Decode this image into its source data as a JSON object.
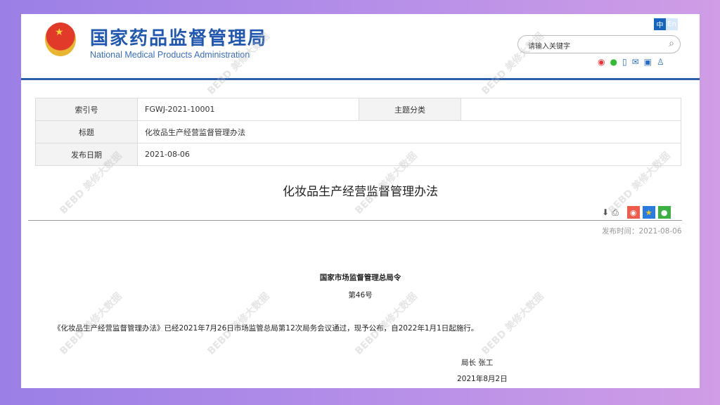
{
  "header": {
    "logo_cn": "国家药品监督管理局",
    "logo_en": "National Medical Products Administration",
    "lang_zh": "中",
    "lang_en": "En",
    "search_placeholder": "请输入关键字"
  },
  "info_table": [
    {
      "label": "索引号",
      "value": "FGWJ-2021-10001",
      "label2": "主题分类",
      "value2": ""
    },
    {
      "label": "标题",
      "value": "化妆品生产经营监督管理办法"
    },
    {
      "label": "发布日期",
      "value": "2021-08-06"
    }
  ],
  "article": {
    "title": "化妆品生产经营监督管理办法",
    "publish_time": "发布时间：2021-08-06",
    "issuer": "国家市场监督管理总局令",
    "number": "第46号",
    "paragraph": "《化妆品生产经营监督管理办法》已经2021年7月26日市场监管总局第12次局务会议通过，现予公布，自2022年1月1日起施行。",
    "signature": "局长 张工",
    "date": "2021年8月2日"
  },
  "watermark": "BEBD 美修大数据"
}
